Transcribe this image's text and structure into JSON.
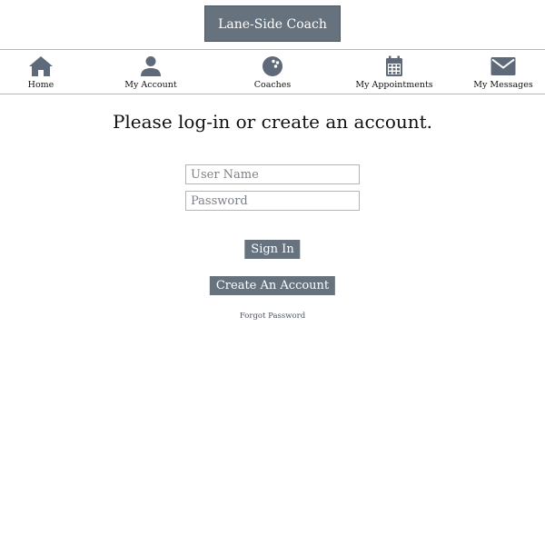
{
  "header": {
    "brand_label": "Lane-Side Coach"
  },
  "nav": {
    "items": [
      {
        "label": "Home",
        "icon": "home-icon"
      },
      {
        "label": "My Account",
        "icon": "user-icon"
      },
      {
        "label": "Coaches",
        "icon": "bowling-ball-icon"
      },
      {
        "label": "My Appointments",
        "icon": "calendar-icon"
      },
      {
        "label": "My Messages",
        "icon": "envelope-icon"
      }
    ]
  },
  "main": {
    "title": "Please log-in or create an account.",
    "username_placeholder": "User Name",
    "password_placeholder": "Password",
    "signin_label": "Sign In",
    "create_label": "Create An Account",
    "forgot_label": "Forgot Password"
  },
  "colors": {
    "accent": "#67727f",
    "icon": "#5e6a79"
  }
}
